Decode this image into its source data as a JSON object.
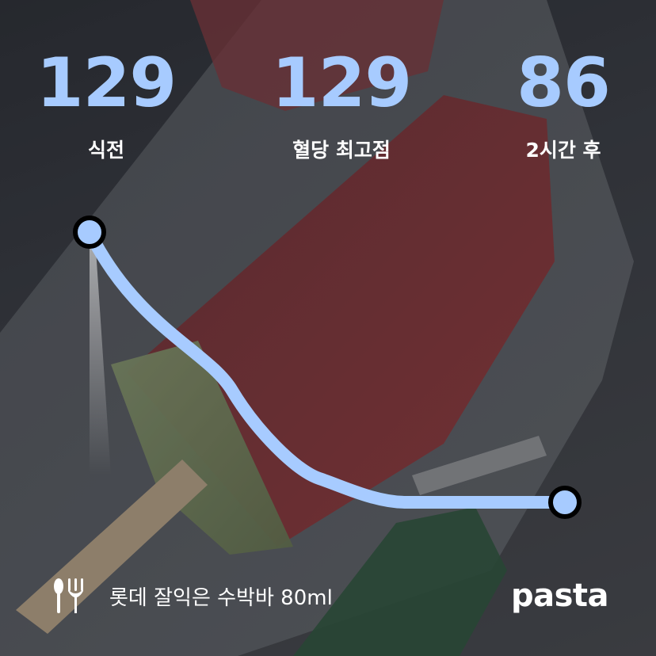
{
  "stats": {
    "before": {
      "value": "129",
      "label": "식전"
    },
    "peak": {
      "value": "129",
      "label": "혈당 최고점"
    },
    "after": {
      "value": "86",
      "label": "2시간 후"
    }
  },
  "chart_data": {
    "type": "line",
    "x_labels": [
      "식전",
      "2시간 후"
    ],
    "series": [
      {
        "values": [
          129,
          86
        ]
      }
    ],
    "line_color": "#a7cbff",
    "accent_color": "#a7cbff"
  },
  "footer": {
    "icon": "fork-knife-icon",
    "food_name": "롯데 잘익은 수박바 80ml",
    "brand": "pasta"
  }
}
